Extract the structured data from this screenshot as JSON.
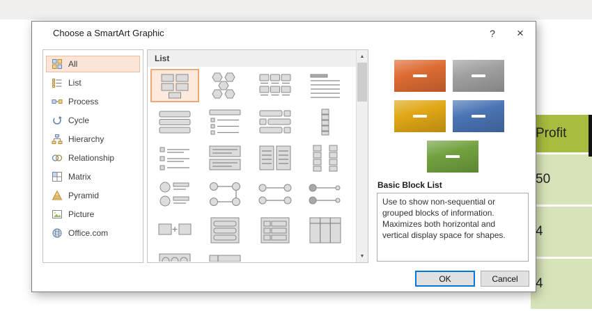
{
  "window": {
    "title": "Choose a SmartArt Graphic",
    "help_glyph": "?",
    "close_glyph": "×"
  },
  "sidebar": {
    "items": [
      {
        "label": "All",
        "icon": "all-categories-icon",
        "selected": true
      },
      {
        "label": "List",
        "icon": "list-category-icon",
        "selected": false
      },
      {
        "label": "Process",
        "icon": "process-category-icon",
        "selected": false
      },
      {
        "label": "Cycle",
        "icon": "cycle-category-icon",
        "selected": false
      },
      {
        "label": "Hierarchy",
        "icon": "hierarchy-category-icon",
        "selected": false
      },
      {
        "label": "Relationship",
        "icon": "relationship-category-icon",
        "selected": false
      },
      {
        "label": "Matrix",
        "icon": "matrix-category-icon",
        "selected": false
      },
      {
        "label": "Pyramid",
        "icon": "pyramid-category-icon",
        "selected": false
      },
      {
        "label": "Picture",
        "icon": "picture-category-icon",
        "selected": false
      },
      {
        "label": "Office.com",
        "icon": "office-com-category-icon",
        "selected": false
      }
    ]
  },
  "gallery": {
    "header": "List",
    "selected_index": 0,
    "scroll_up_glyph": "▲",
    "scroll_down_glyph": "▼",
    "thumbnails": [
      "basic-block-list",
      "hexagon-cluster",
      "caption-grid",
      "ruled-lines",
      "stacked-bars",
      "header-bullet-list",
      "staggered-bars",
      "vertical-segments",
      "bullet-lines",
      "text-boxes",
      "grouped-columns",
      "paired-columns",
      "picture-pairs",
      "connected-loop",
      "node-link-row",
      "node-link-row-alt",
      "plus-boxes",
      "framed-list",
      "framed-accent-list",
      "three-column-table",
      "dial-shapes",
      "segmented-bars"
    ]
  },
  "preview": {
    "name": "Basic Block List",
    "description": "Use to show non-sequential or grouped blocks of information. Maximizes both horizontal and vertical display space for shapes.",
    "blocks": [
      {
        "color": "#dd6b33"
      },
      {
        "color": "#a0a0a0"
      },
      {
        "color": "#e0a716"
      },
      {
        "color": "#4a74b4"
      },
      {
        "color": "#71a23f"
      }
    ]
  },
  "footer": {
    "ok_label": "OK",
    "cancel_label": "Cancel"
  },
  "background_table": {
    "header": "Profit",
    "rows": [
      "50",
      "4",
      "4"
    ],
    "header_color": "#a8bc40",
    "cell_color": "#d7e3b8"
  }
}
